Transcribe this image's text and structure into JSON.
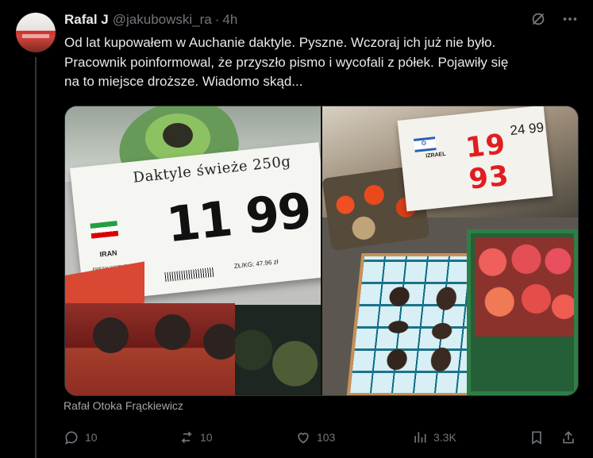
{
  "post": {
    "name": "Rafal J",
    "handle": "@jakubowski_ra",
    "separator": "·",
    "time": "4h",
    "text_lines": [
      "Od lat kupowałem w Auchanie daktyle. Pyszne.  Wczoraj ich już nie było.",
      "Pracownik poinformowal, że przyszło pismo i wycofali z półek. Pojawiły się",
      "na to miejsce droższe. Wiadomo skąd..."
    ],
    "byline": "Rafał Otoka Frąckiewicz"
  },
  "images": {
    "left": {
      "label_title": "Daktyle świeże 250g",
      "price": "11 99",
      "country": "IRAN",
      "supplier": "FRESH WORLD INTERNATIONAL SP Z",
      "unit_price": "ZŁ/KG: 47.96 zł"
    },
    "right": {
      "country": "IZRAEL",
      "price": "19 93",
      "old_price": "24 99"
    }
  },
  "actions": {
    "reply_count": "10",
    "repost_count": "10",
    "like_count": "103",
    "views_count": "3.3K"
  },
  "icons": {
    "grok": "grok-icon",
    "more": "more-icon",
    "reply": "reply-icon",
    "repost": "repost-icon",
    "like": "heart-icon",
    "views": "views-icon",
    "bookmark": "bookmark-icon",
    "share": "share-icon"
  },
  "colors": {
    "background": "#000000",
    "text": "#e7e9ea",
    "muted": "#71767b",
    "border": "#2f3336",
    "red_price": "#e11d20"
  }
}
